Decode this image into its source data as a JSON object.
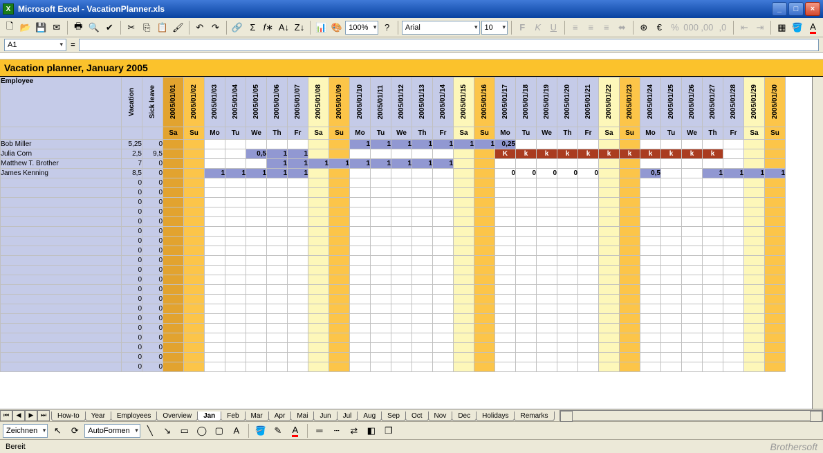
{
  "window": {
    "app": "Microsoft Excel",
    "doc": "VacationPlanner.xls"
  },
  "toolbar": {
    "zoom": "100%",
    "font": "Arial",
    "size": "10"
  },
  "formulabar": {
    "cell": "A1",
    "fx": "="
  },
  "sheet": {
    "title": "Vacation planner, January 2005",
    "headers": {
      "employee": "Employee",
      "vacation": "Vacation",
      "sick": "Sick leave"
    },
    "days": [
      {
        "date": "2005/01/01",
        "dow": "Sa",
        "type": "dk"
      },
      {
        "date": "2005/01/02",
        "dow": "Su",
        "type": "sun"
      },
      {
        "date": "2005/01/03",
        "dow": "Mo",
        "type": ""
      },
      {
        "date": "2005/01/04",
        "dow": "Tu",
        "type": ""
      },
      {
        "date": "2005/01/05",
        "dow": "We",
        "type": ""
      },
      {
        "date": "2005/01/06",
        "dow": "Th",
        "type": ""
      },
      {
        "date": "2005/01/07",
        "dow": "Fr",
        "type": ""
      },
      {
        "date": "2005/01/08",
        "dow": "Sa",
        "type": "sat"
      },
      {
        "date": "2005/01/09",
        "dow": "Su",
        "type": "sun"
      },
      {
        "date": "2005/01/10",
        "dow": "Mo",
        "type": ""
      },
      {
        "date": "2005/01/11",
        "dow": "Tu",
        "type": ""
      },
      {
        "date": "2005/01/12",
        "dow": "We",
        "type": ""
      },
      {
        "date": "2005/01/13",
        "dow": "Th",
        "type": ""
      },
      {
        "date": "2005/01/14",
        "dow": "Fr",
        "type": ""
      },
      {
        "date": "2005/01/15",
        "dow": "Sa",
        "type": "sat"
      },
      {
        "date": "2005/01/16",
        "dow": "Su",
        "type": "sun"
      },
      {
        "date": "2005/01/17",
        "dow": "Mo",
        "type": ""
      },
      {
        "date": "2005/01/18",
        "dow": "Tu",
        "type": ""
      },
      {
        "date": "2005/01/19",
        "dow": "We",
        "type": ""
      },
      {
        "date": "2005/01/20",
        "dow": "Th",
        "type": ""
      },
      {
        "date": "2005/01/21",
        "dow": "Fr",
        "type": ""
      },
      {
        "date": "2005/01/22",
        "dow": "Sa",
        "type": "sat"
      },
      {
        "date": "2005/01/23",
        "dow": "Su",
        "type": "sun"
      },
      {
        "date": "2005/01/24",
        "dow": "Mo",
        "type": ""
      },
      {
        "date": "2005/01/25",
        "dow": "Tu",
        "type": ""
      },
      {
        "date": "2005/01/26",
        "dow": "We",
        "type": ""
      },
      {
        "date": "2005/01/27",
        "dow": "Th",
        "type": ""
      },
      {
        "date": "2005/01/28",
        "dow": "Fr",
        "type": ""
      },
      {
        "date": "2005/01/29",
        "dow": "Sa",
        "type": "sat"
      },
      {
        "date": "2005/01/30",
        "dow": "Su",
        "type": "sun"
      }
    ],
    "rows": [
      {
        "name": "Bob Miller",
        "vac": "5,25",
        "sick": "0",
        "cells": [
          null,
          null,
          null,
          null,
          null,
          null,
          null,
          null,
          null,
          {
            "v": "1",
            "c": "v"
          },
          {
            "v": "1",
            "c": "v"
          },
          {
            "v": "1",
            "c": "v"
          },
          {
            "v": "1",
            "c": "v"
          },
          {
            "v": "1",
            "c": "v"
          },
          {
            "v": "1",
            "c": "v"
          },
          {
            "v": "1",
            "c": "v"
          },
          {
            "v": "0,25",
            "c": "v"
          },
          null,
          null,
          null,
          null,
          null,
          null,
          null,
          null,
          null,
          null,
          null,
          null,
          null
        ]
      },
      {
        "name": "Julia Corn",
        "vac": "2,5",
        "sick": "9,5",
        "cells": [
          null,
          null,
          null,
          null,
          {
            "v": "0,5",
            "c": "v"
          },
          {
            "v": "1",
            "c": "v"
          },
          {
            "v": "1",
            "c": "v"
          },
          null,
          null,
          null,
          null,
          null,
          null,
          null,
          null,
          null,
          {
            "v": "K",
            "c": "k"
          },
          {
            "v": "k",
            "c": "k"
          },
          {
            "v": "k",
            "c": "k"
          },
          {
            "v": "k",
            "c": "k"
          },
          {
            "v": "k",
            "c": "k"
          },
          {
            "v": "k",
            "c": "k"
          },
          {
            "v": "k",
            "c": "k"
          },
          {
            "v": "k",
            "c": "k"
          },
          {
            "v": "k",
            "c": "k"
          },
          {
            "v": "k",
            "c": "k"
          },
          {
            "v": "k",
            "c": "k"
          },
          null,
          null,
          null
        ]
      },
      {
        "name": "Matthew T. Brother",
        "vac": "7",
        "sick": "0",
        "cells": [
          null,
          null,
          null,
          null,
          null,
          {
            "v": "1",
            "c": "v"
          },
          {
            "v": "1",
            "c": "v"
          },
          {
            "v": "1",
            "c": "v"
          },
          {
            "v": "1",
            "c": "v"
          },
          {
            "v": "1",
            "c": "v"
          },
          {
            "v": "1",
            "c": "v"
          },
          {
            "v": "1",
            "c": "v"
          },
          {
            "v": "1",
            "c": "v"
          },
          {
            "v": "1",
            "c": "v"
          },
          null,
          null,
          null,
          null,
          null,
          null,
          null,
          null,
          null,
          null,
          null,
          null,
          null,
          null,
          null,
          null
        ]
      },
      {
        "name": "James Kenning",
        "vac": "8,5",
        "sick": "0",
        "cells": [
          null,
          null,
          {
            "v": "1",
            "c": "v"
          },
          {
            "v": "1",
            "c": "v"
          },
          {
            "v": "1",
            "c": "v"
          },
          {
            "v": "1",
            "c": "v"
          },
          {
            "v": "1",
            "c": "v"
          },
          null,
          null,
          null,
          null,
          null,
          null,
          null,
          null,
          null,
          {
            "v": "0",
            "c": "s"
          },
          {
            "v": "0",
            "c": "s"
          },
          {
            "v": "0",
            "c": "s"
          },
          {
            "v": "0",
            "c": "s"
          },
          {
            "v": "0",
            "c": "s"
          },
          null,
          null,
          {
            "v": "0,5",
            "c": "v"
          },
          null,
          null,
          {
            "v": "1",
            "c": "v"
          },
          {
            "v": "1",
            "c": "v"
          },
          {
            "v": "1",
            "c": "v"
          },
          {
            "v": "1",
            "c": "v"
          }
        ]
      }
    ],
    "empty_rows": 20
  },
  "tabs": [
    "How-to",
    "Year",
    "Employees",
    "Overview",
    "Jan",
    "Feb",
    "Mar",
    "Apr",
    "Mai",
    "Jun",
    "Jul",
    "Aug",
    "Sep",
    "Oct",
    "Nov",
    "Dec",
    "Holidays",
    "Remarks"
  ],
  "active_tab": "Jan",
  "drawbar": {
    "zeichnen": "Zeichnen",
    "autoformen": "AutoFormen"
  },
  "status": {
    "ready": "Bereit",
    "brand": "Brothersoft"
  }
}
